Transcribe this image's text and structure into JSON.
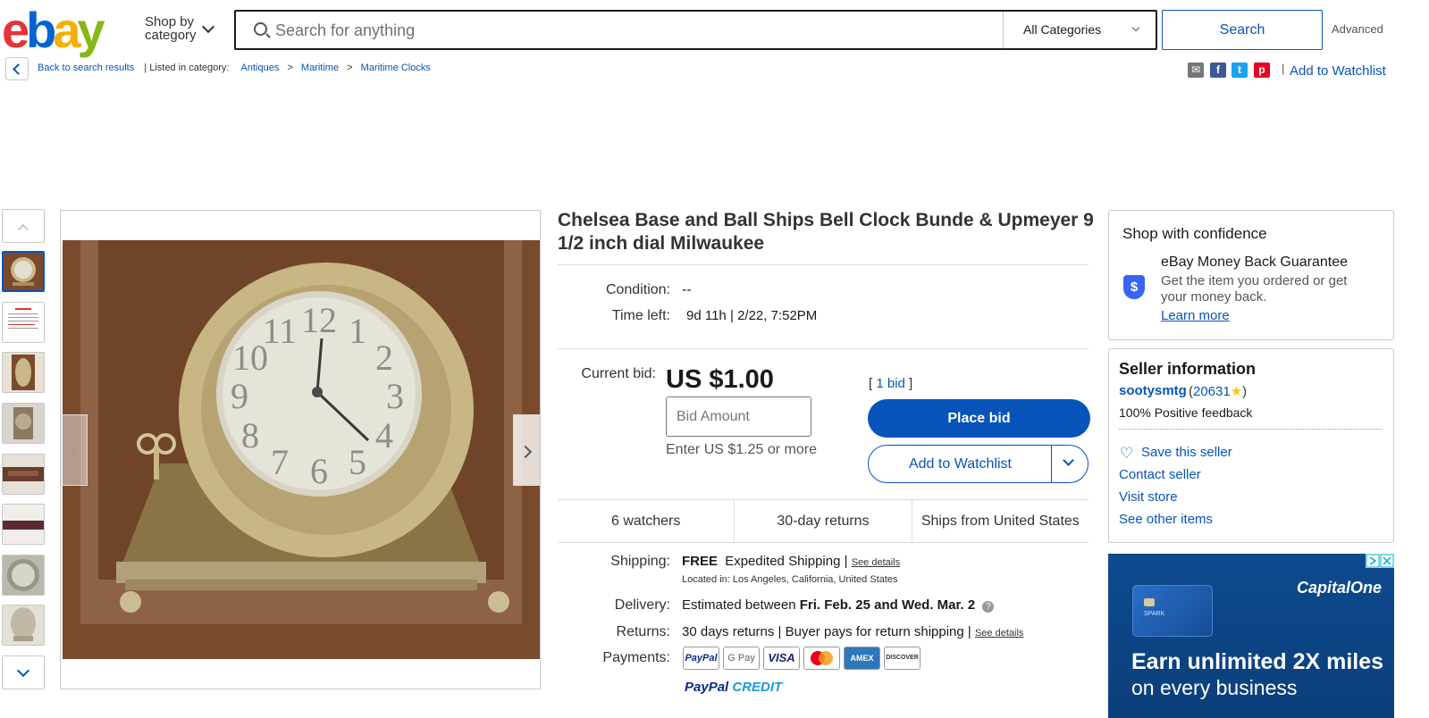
{
  "header": {
    "logo": "ebay",
    "shop_by": "Shop by",
    "shop_by_2": "category",
    "search_placeholder": "Search for anything",
    "category_select": "All Categories",
    "search_button": "Search",
    "advanced": "Advanced"
  },
  "breadcrumb": {
    "back": "Back to search results",
    "listed_in": "| Listed in category:",
    "items": [
      "Antiques",
      "Maritime",
      "Maritime Clocks"
    ],
    "sep": ">",
    "add_to_watchlist": "Add to Watchlist"
  },
  "item": {
    "title": "Chelsea Base and Ball Ships Bell Clock Bunde & Upmeyer 9 1/2 inch dial Milwaukee",
    "condition_label": "Condition:",
    "condition_value": "--",
    "time_left_label": "Time left:",
    "time_left_value": "9d 11h",
    "time_end": "| 2/22, 7:52PM",
    "current_bid_label": "Current bid:",
    "price": "US $1.00",
    "bid_count_open": "[",
    "bid_count": "1 bid",
    "bid_count_close": "]",
    "bid_placeholder": "Bid Amount",
    "bid_hint": "Enter US $1.25 or more",
    "place_bid": "Place bid",
    "add_to_watchlist": "Add to Watchlist",
    "stats": [
      "6 watchers",
      "30-day returns",
      "Ships from United States"
    ],
    "shipping_label": "Shipping:",
    "shipping_free": "FREE",
    "shipping_method": "Expedited Shipping |",
    "see_details": "See details",
    "location": "Located in:  Los Angeles, California, United States",
    "delivery_label": "Delivery:",
    "delivery_text": "Estimated between",
    "delivery_dates": "Fri. Feb. 25 and Wed. Mar. 2",
    "returns_label": "Returns:",
    "returns_text": "30 days returns | Buyer pays for return shipping |",
    "payments_label": "Payments:",
    "payments": [
      "PayPal",
      "G Pay",
      "VISA",
      "MC",
      "AMEX",
      "DISCOVER"
    ],
    "paypal_credit": "PayPal",
    "paypal_credit_2": "CREDIT"
  },
  "confidence": {
    "title": "Shop with confidence",
    "guarantee_title": "eBay Money Back Guarantee",
    "guarantee_text_1": "Get the item you ordered or get",
    "guarantee_text_2": "your money back.",
    "learn_more": "Learn more"
  },
  "seller": {
    "title": "Seller information",
    "name": "sootysmtg",
    "score_open": "(",
    "score": "20631",
    "score_close": ")",
    "feedback": "100% Positive feedback",
    "save": "Save this seller",
    "contact": "Contact seller",
    "visit": "Visit store",
    "other": "See other items"
  },
  "ad": {
    "brand": "CapitalOne",
    "headline": "Earn unlimited 2X miles",
    "subline": "on every business",
    "card_text": "SPARK"
  },
  "colors": {
    "link": "#0654ba",
    "primary_button": "#0654ba",
    "ad_bg": "#0d4a8f"
  }
}
